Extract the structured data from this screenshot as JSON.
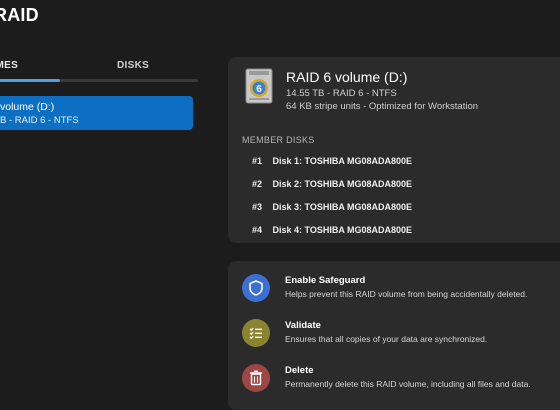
{
  "app": {
    "title": "RAID"
  },
  "tabs": [
    {
      "label": "UMES"
    },
    {
      "label": "DISKS"
    }
  ],
  "volume_list": [
    {
      "name": "volume (D:)",
      "desc": "B - RAID 6 - NTFS"
    }
  ],
  "volume": {
    "title": "RAID 6 volume (D:)",
    "summary": "14.55 TB - RAID 6 - NTFS",
    "details": "64 KB stripe units - Optimized for Workstation",
    "icon": "raid-drive-icon"
  },
  "members": {
    "heading": "MEMBER DISKS",
    "disks": [
      {
        "num": "#1",
        "label": "Disk 1: TOSHIBA MG08ADA800E"
      },
      {
        "num": "#2",
        "label": "Disk 2: TOSHIBA MG08ADA800E"
      },
      {
        "num": "#3",
        "label": "Disk 3: TOSHIBA MG08ADA800E"
      },
      {
        "num": "#4",
        "label": "Disk 4: TOSHIBA MG08ADA800E"
      }
    ]
  },
  "actions": [
    {
      "title": "Enable Safeguard",
      "desc": "Helps prevent this RAID volume from being accidentally deleted.",
      "icon": "shield-icon",
      "color": "#3b6fd1"
    },
    {
      "title": "Validate",
      "desc": "Ensures that all copies of your data are synchronized.",
      "icon": "checklist-icon",
      "color": "#8a8430"
    },
    {
      "title": "Delete",
      "desc": "Permanently delete this RAID volume, including all files and data.",
      "icon": "trash-icon",
      "color": "#9c4646"
    }
  ],
  "colors": {
    "accent": "#0d6fc4",
    "background": "#1c1c1c",
    "card": "#2b2b2b"
  }
}
